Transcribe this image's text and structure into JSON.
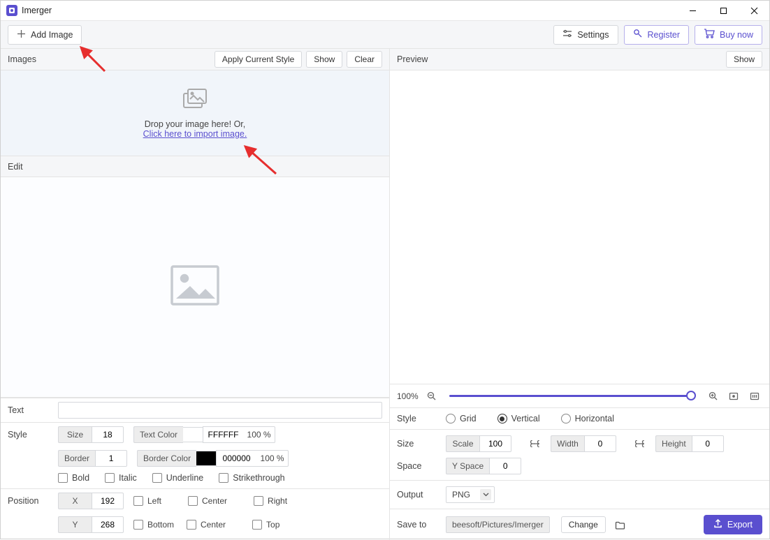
{
  "app": {
    "title": "Imerger"
  },
  "toolbar": {
    "add_image": "Add Image",
    "settings": "Settings",
    "register": "Register",
    "buy_now": "Buy now"
  },
  "images_panel": {
    "title": "Images",
    "apply_style": "Apply Current Style",
    "show": "Show",
    "clear": "Clear",
    "drop_text": "Drop your image here! Or,",
    "import_link": "Click here to import image."
  },
  "edit_panel": {
    "title": "Edit",
    "text_label": "Text",
    "text_value": "",
    "style_label": "Style",
    "size": {
      "label": "Size",
      "value": "18"
    },
    "border": {
      "label": "Border",
      "value": "1"
    },
    "text_color": {
      "label": "Text Color",
      "value": "FFFFFF",
      "pct": "100 %",
      "swatch": "#ffffff"
    },
    "border_color": {
      "label": "Border Color",
      "value": "000000",
      "pct": "100 %",
      "swatch": "#000000"
    },
    "bold": "Bold",
    "italic": "Italic",
    "underline": "Underline",
    "strike": "Strikethrough",
    "position_label": "Position",
    "x": {
      "label": "X",
      "value": "192"
    },
    "y": {
      "label": "Y",
      "value": "268"
    },
    "left": "Left",
    "center": "Center",
    "right": "Right",
    "bottom": "Bottom",
    "top": "Top"
  },
  "preview_panel": {
    "title": "Preview",
    "show": "Show",
    "zoom_pct": "100%",
    "style_label": "Style",
    "grid": "Grid",
    "vertical": "Vertical",
    "horizontal": "Horizontal",
    "size_label": "Size",
    "scale": {
      "label": "Scale",
      "value": "100"
    },
    "width": {
      "label": "Width",
      "value": "0"
    },
    "height": {
      "label": "Height",
      "value": "0"
    },
    "space_label": "Space",
    "yspace": {
      "label": "Y Space",
      "value": "0"
    },
    "output_label": "Output",
    "output_value": "PNG",
    "save_label": "Save to",
    "save_path": "beesoft/Pictures/Imerger",
    "change": "Change",
    "export": "Export"
  }
}
